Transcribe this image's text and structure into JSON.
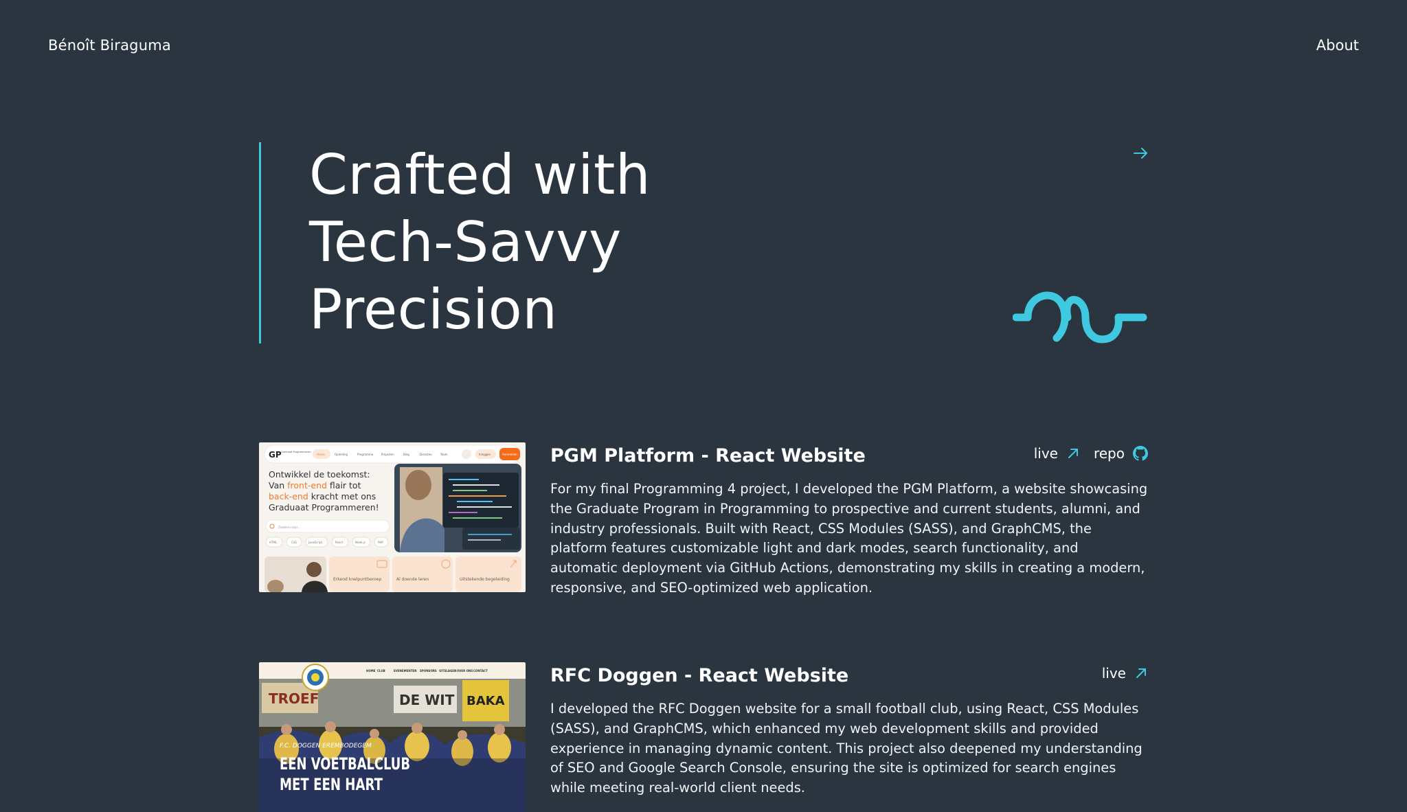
{
  "header": {
    "site_name": "Bénoît Biraguma",
    "nav_about": "About"
  },
  "hero": {
    "title_lines": [
      "Crafted with",
      "Tech-Savvy",
      "Precision"
    ],
    "accent_color": "#3ec9e0",
    "arrow_icon": "arrow-right-icon",
    "logo_icon": "glasses-logo-icon"
  },
  "projects": [
    {
      "title": "PGM Platform - React Website",
      "live_label": "live",
      "repo_label": "repo",
      "description": "For my final Programming 4 project, I developed the PGM Platform, a website showcasing the Graduate Program in Programming to prospective and current students, alumni, and industry professionals. Built with React, CSS Modules (SASS), and GraphCMS, the platform features customizable light and dark modes, search functionality, and automatic deployment via GitHub Actions, demonstrating my skills in creating a modern, responsive, and SEO-optimized web application.",
      "thumbnail": {
        "logo_text": "GP",
        "logo_sub": "Graduaat Programmeren",
        "nav_items": [
          "Home",
          "Opleiding",
          "Programma",
          "Projecten",
          "Blog",
          "Diensten",
          "Team"
        ],
        "nav_login": "Inloggen",
        "nav_cta": "Aanmelden",
        "headline_1": "Ontwikkel de toekomst:",
        "headline_2a": "Van ",
        "headline_2b": "front-end",
        "headline_2c": " flair tot",
        "headline_3a": "back-end",
        "headline_3b": " kracht met ons",
        "headline_4": "Graduaat Programmeren!",
        "search_placeholder": "Zoeken naar...",
        "tags": [
          "HTML",
          "CSS",
          "JavaScript",
          "React",
          "Node.js",
          "PHP"
        ],
        "cards": [
          "Erkend knelpuntberoep",
          "Al doende leren",
          "Uitstekende begeleiding"
        ]
      }
    },
    {
      "title": "RFC Doggen - React Website",
      "live_label": "live",
      "description": "I developed the RFC Doggen website for a small football club, using React, CSS Modules (SASS), and GraphCMS, which enhanced my web development skills and provided experience in managing dynamic content. This project also deepened my understanding of SEO and Google Search Console, ensuring the site is optimized for search engines while meeting real-world client needs.",
      "thumbnail": {
        "nav_items": [
          "HOME",
          "CLUB",
          "EVENEMENTEN",
          "SPONSORS",
          "UITSLAGEN",
          "OVER ONS",
          "CONTACT"
        ],
        "kicker": "F.C. DOGGEN EREMBODEGEM",
        "headline_1": "EEN VOETBALCLUB",
        "headline_2": "MET EEN HART",
        "banner_1": "TROEF",
        "banner_2": "DE WIT",
        "banner_3": "BAKA"
      }
    }
  ],
  "colors": {
    "background": "#2b3540",
    "accent": "#3ec9e0",
    "text": "#ffffff"
  }
}
